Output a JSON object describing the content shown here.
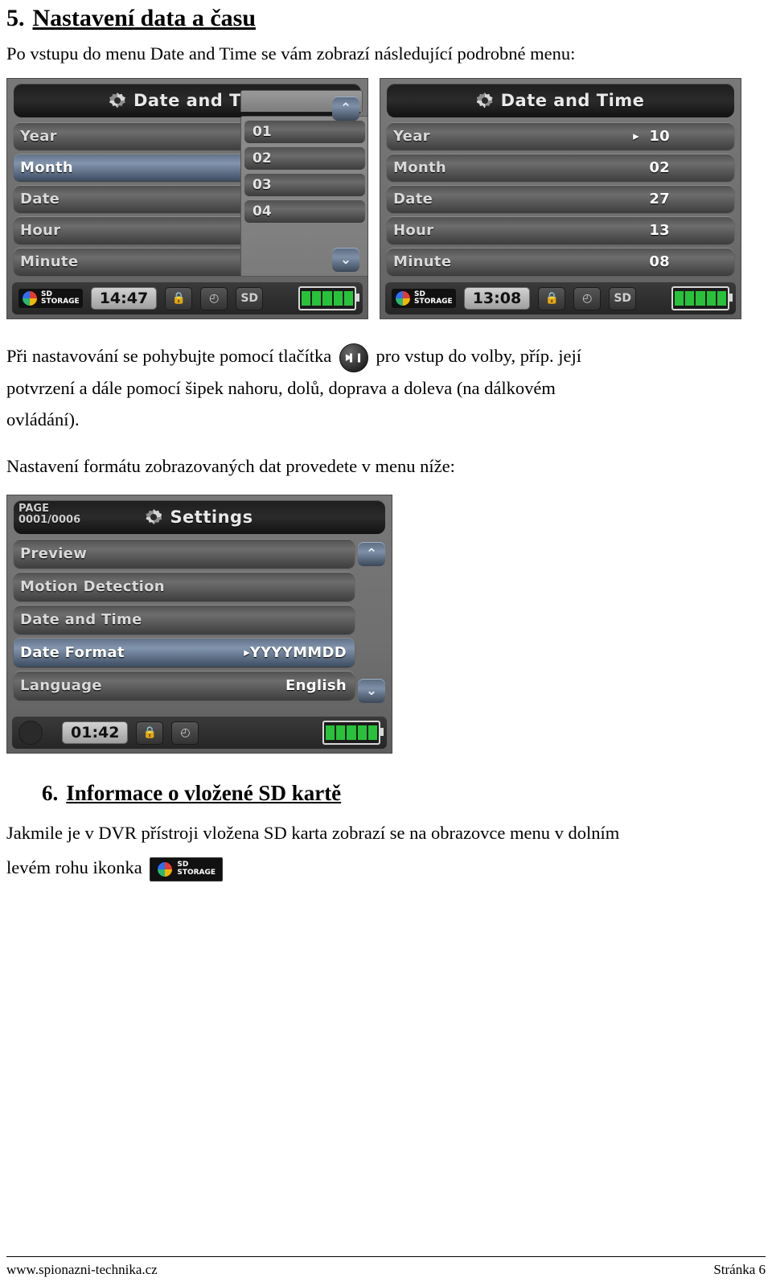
{
  "section5": {
    "number": "5.",
    "title": "Nastavení data a času",
    "intro": "Po vstupu do menu Date and Time se vám zobrazí následující podrobné menu:"
  },
  "shot1": {
    "name": "date-and-time-menu-left",
    "title": "Date and Tim",
    "rows": [
      {
        "label": "Year",
        "value": "",
        "selected": false
      },
      {
        "label": "Month",
        "value": "",
        "selected": true,
        "caret": "▸"
      },
      {
        "label": "Date",
        "value": "",
        "selected": false
      },
      {
        "label": "Hour",
        "value": "",
        "selected": false
      },
      {
        "label": "Minute",
        "value": "",
        "selected": false
      }
    ],
    "popup_items": [
      "01",
      "02",
      "03",
      "04"
    ],
    "scroll_up": "⌃",
    "scroll_down": "⌄",
    "status": {
      "sd_label_line1": "SD",
      "sd_label_line2": "STORAGE",
      "clock": "14:47",
      "lock_icon": "🔒",
      "timer_icon": "◴",
      "sd_icon": "SD"
    }
  },
  "shot2": {
    "name": "date-and-time-menu-right",
    "title": "Date and Time",
    "rows": [
      {
        "label": "Year",
        "value": "10",
        "selected": false,
        "caret": "▸"
      },
      {
        "label": "Month",
        "value": "02",
        "selected": false
      },
      {
        "label": "Date",
        "value": "27",
        "selected": false
      },
      {
        "label": "Hour",
        "value": "13",
        "selected": false
      },
      {
        "label": "Minute",
        "value": "08",
        "selected": false
      }
    ],
    "status": {
      "sd_label_line1": "SD",
      "sd_label_line2": "STORAGE",
      "clock": "13:08",
      "lock_icon": "🔒",
      "timer_icon": "◴",
      "sd_icon": "SD"
    }
  },
  "middle_text": {
    "line1_part1": "Při nastavování se pohybujte pomocí tlačítka",
    "line1_part2": "pro vstup do volby, příp. její",
    "line2": "potvrzení a dále pomocí šipek nahoru, dolů, doprava a doleva (na dálkovém",
    "line3": "ovládání).",
    "line4": "Nastavení formátu zobrazovaných dat provedete v menu níže:"
  },
  "shot3": {
    "name": "settings-menu",
    "page_line1": "PAGE",
    "page_line2": "0001/0006",
    "title": "Settings",
    "rows": [
      {
        "label": "Preview",
        "value": "",
        "selected": false
      },
      {
        "label": "Motion Detection",
        "value": "",
        "selected": false
      },
      {
        "label": "Date and Time",
        "value": "",
        "selected": false
      },
      {
        "label": "Date Format",
        "value": "YYYYMMDD",
        "selected": true,
        "caret": "▸"
      },
      {
        "label": "Language",
        "value": "English",
        "selected": false
      }
    ],
    "scroll_up": "⌃",
    "scroll_down": "⌄",
    "status": {
      "clock": "01:42",
      "lock_icon": "🔒",
      "timer_icon": "◴"
    }
  },
  "section6": {
    "number": "6.",
    "title": "Informace o vložené SD kartě",
    "line1": "Jakmile je v DVR přístroji vložena SD karta zobrazí se na obrazovce menu v dolním",
    "line2": "levém rohu ikonka",
    "sd_icon_line1": "SD",
    "sd_icon_line2": "STORAGE"
  },
  "footer": {
    "site": "www.spionazni-technika.cz",
    "page": "Stránka 6"
  },
  "colors": {
    "selected_row": "#8295ae",
    "battery_green": "#28c23a",
    "lcd_bg": "#6b6b6b"
  }
}
